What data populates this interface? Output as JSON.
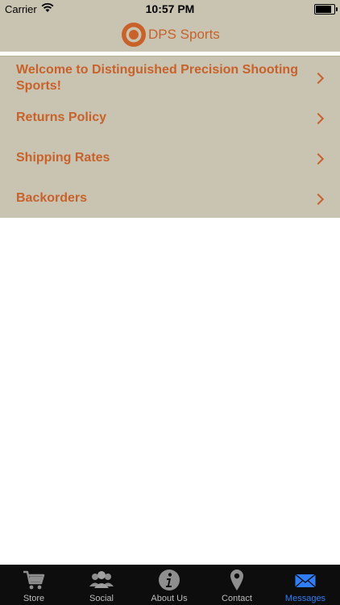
{
  "status_bar": {
    "carrier": "Carrier",
    "time": "10:57 PM",
    "battery_level": 0.95
  },
  "header": {
    "brand_name": "DPS Sports",
    "brand_color": "#c8622a",
    "background": "#c9c3b2"
  },
  "messages": [
    {
      "label": "Welcome to Distinguished Precision Shooting Sports!"
    },
    {
      "label": "Returns Policy"
    },
    {
      "label": "Shipping Rates"
    },
    {
      "label": "Backorders"
    }
  ],
  "tabs": [
    {
      "label": "Store",
      "icon": "cart-icon",
      "active": false
    },
    {
      "label": "Social",
      "icon": "people-icon",
      "active": false
    },
    {
      "label": "About Us",
      "icon": "info-icon",
      "active": false
    },
    {
      "label": "Contact",
      "icon": "map-pin-icon",
      "active": false
    },
    {
      "label": "Messages",
      "icon": "envelope-icon",
      "active": true
    }
  ],
  "colors": {
    "active_tab": "#2d7ef8",
    "inactive_tab": "#8e8e8e",
    "tab_bar": "#0d0d0d"
  }
}
